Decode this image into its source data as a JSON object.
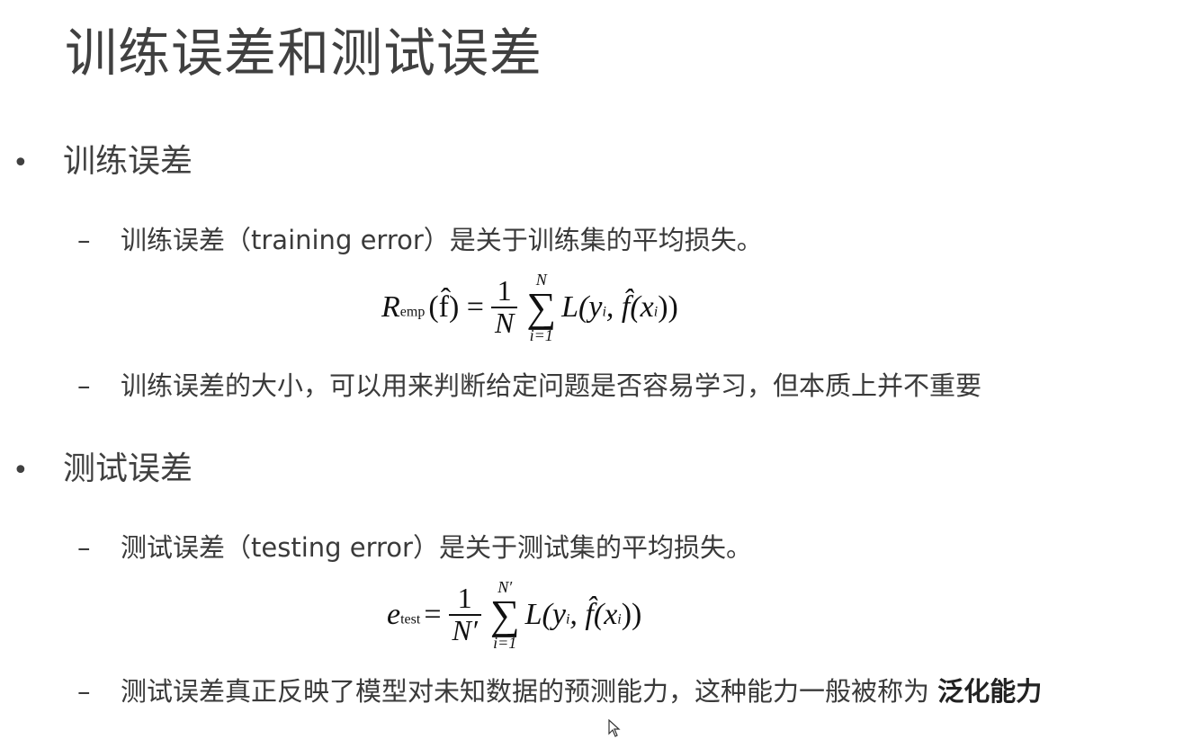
{
  "title": "训练误差和测试误差",
  "sections": [
    {
      "bullet": "训练误差",
      "items": [
        "训练误差（training error）是关于训练集的平均损失。",
        "训练误差的大小，可以用来判断给定问题是否容易学习，但本质上并不重要"
      ],
      "formula": {
        "lhs": "R",
        "lhs_sub": "emp",
        "arg": "(f̂) =",
        "num": "1",
        "den": "N",
        "sum_top": "N",
        "sum_bot": "i=1",
        "body": "L(y",
        "body_sub": "i",
        "body2": ", f̂(x",
        "body2_sub": "i",
        "body3": "))"
      }
    },
    {
      "bullet": "测试误差",
      "items": [
        "测试误差（testing error）是关于测试集的平均损失。",
        "测试误差真正反映了模型对未知数据的预测能力，这种能力一般被称为 ",
        "泛化能力"
      ],
      "formula": {
        "lhs": "e",
        "lhs_sub": "test",
        "arg": "=",
        "num": "1",
        "den": "N′",
        "sum_top": "N′",
        "sum_bot": "i=1",
        "body": "L(y",
        "body_sub": "i",
        "body2": ", f̂(x",
        "body2_sub": "i",
        "body3": "))"
      }
    }
  ],
  "bullet_symbol": "•",
  "dash_symbol": "–",
  "icons": {
    "cursor": "mouse-pointer-icon"
  }
}
